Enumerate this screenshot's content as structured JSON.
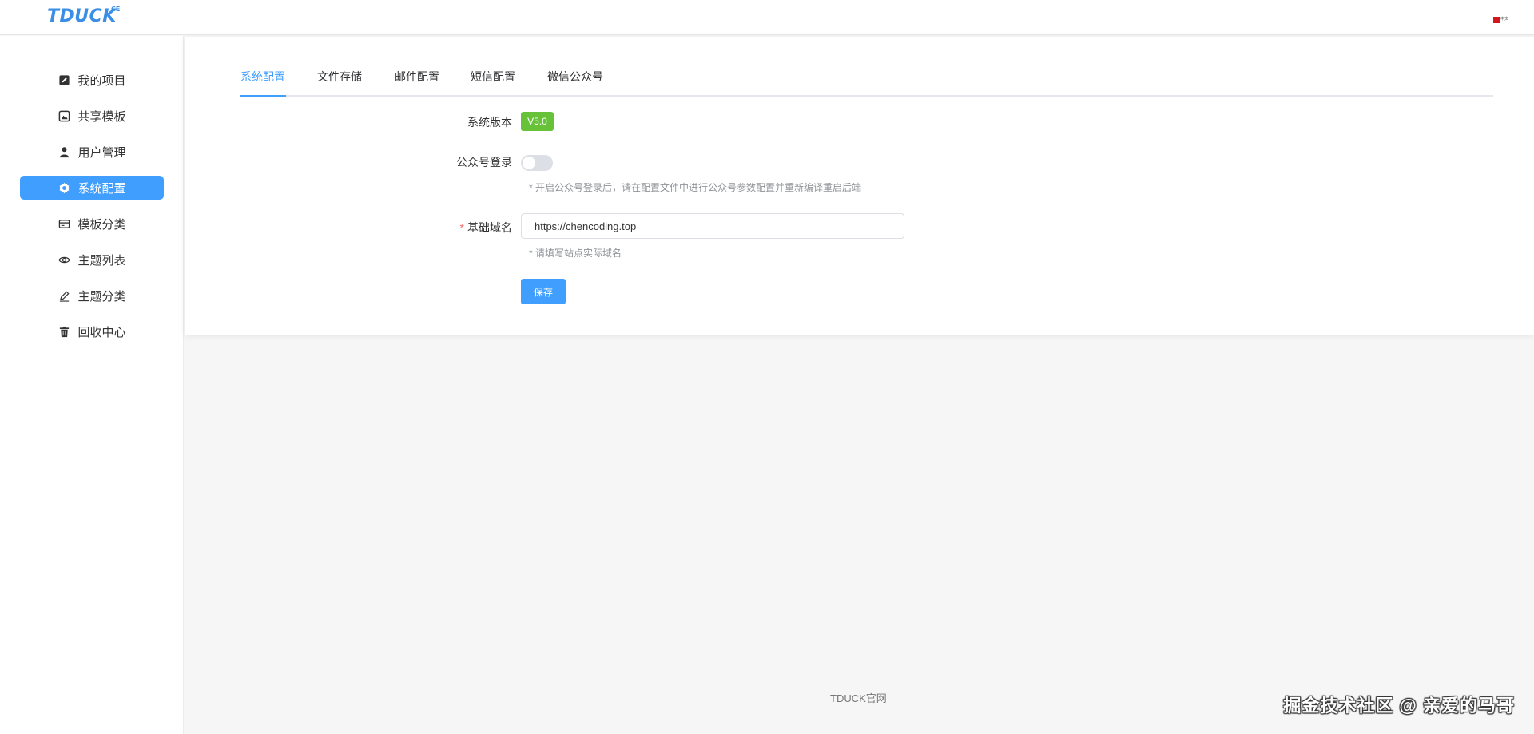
{
  "header": {
    "logo": "TDUCK",
    "logo_sup": "CE",
    "lang_text": "中文"
  },
  "sidebar": {
    "items": [
      {
        "label": "我的项目",
        "icon": "edit-square-icon"
      },
      {
        "label": "共享模板",
        "icon": "image-icon"
      },
      {
        "label": "用户管理",
        "icon": "user-icon"
      },
      {
        "label": "系统配置",
        "icon": "gear-icon",
        "active": true
      },
      {
        "label": "模板分类",
        "icon": "card-icon"
      },
      {
        "label": "主题列表",
        "icon": "eye-icon"
      },
      {
        "label": "主题分类",
        "icon": "pen-icon"
      },
      {
        "label": "回收中心",
        "icon": "trash-icon"
      }
    ]
  },
  "tabs": [
    "系统配置",
    "文件存储",
    "邮件配置",
    "短信配置",
    "微信公众号"
  ],
  "active_tab": 0,
  "form": {
    "version_label": "系统版本",
    "version_value": "V5.0",
    "mp_login_label": "公众号登录",
    "mp_login_enabled": false,
    "mp_login_hint": "* 开启公众号登录后，请在配置文件中进行公众号参数配置并重新编译重启后端",
    "domain_required_mark": "*",
    "domain_label": "基础域名",
    "domain_value": "https://chencoding.top",
    "domain_hint": "* 请填写站点实际域名",
    "save_label": "保存"
  },
  "footer": {
    "link": "TDUCK官网",
    "watermark": "掘金技术社区 @ 亲爱的马哥"
  },
  "colors": {
    "primary": "#409eff",
    "version_tag": "#67c23a",
    "required": "#f56c6c"
  }
}
